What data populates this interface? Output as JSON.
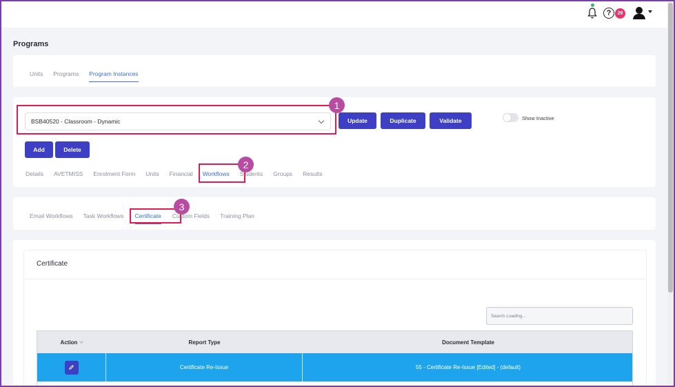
{
  "topbar": {
    "notification_badge": "29",
    "help_glyph": "?",
    "icons": [
      "bell-icon",
      "help-icon",
      "user-icon",
      "caret-down-icon"
    ]
  },
  "page": {
    "title": "Programs"
  },
  "primary_tabs": [
    "Units",
    "Programs",
    "Program Instances"
  ],
  "instance": {
    "selected": "BSB40520 - Classroom - Dynamic",
    "buttons": {
      "update": "Update",
      "duplicate": "Duplicate",
      "validate": "Validate",
      "add": "Add",
      "delete": "Delete"
    },
    "toggle_label": "Show Inactive"
  },
  "section_tabs": [
    "Details",
    "AVETMISS",
    "Enrolment Form",
    "Units",
    "Financial",
    "Workflows",
    "Students",
    "Groups",
    "Results"
  ],
  "workflow_tabs": [
    "Email Workflows",
    "Task Workflows",
    "Certificate",
    "Custom Fields",
    "Training Plan"
  ],
  "certificate": {
    "title": "Certificate",
    "search_placeholder": "Search Loading...",
    "columns": [
      "Action",
      "Report Type",
      "Document Template"
    ],
    "rows": [
      {
        "report_type": "Certificate Re-Issue",
        "document_template": "55 - Certificate Re-Issue [Edited] - (default)"
      }
    ]
  },
  "annotations": [
    "1",
    "2",
    "3"
  ],
  "colors": {
    "accent": "#3d3fc4",
    "link": "#3a6fd8",
    "highlight": "#e21a4f",
    "row_selected": "#1da4ec",
    "marker": "#b84ca3"
  }
}
